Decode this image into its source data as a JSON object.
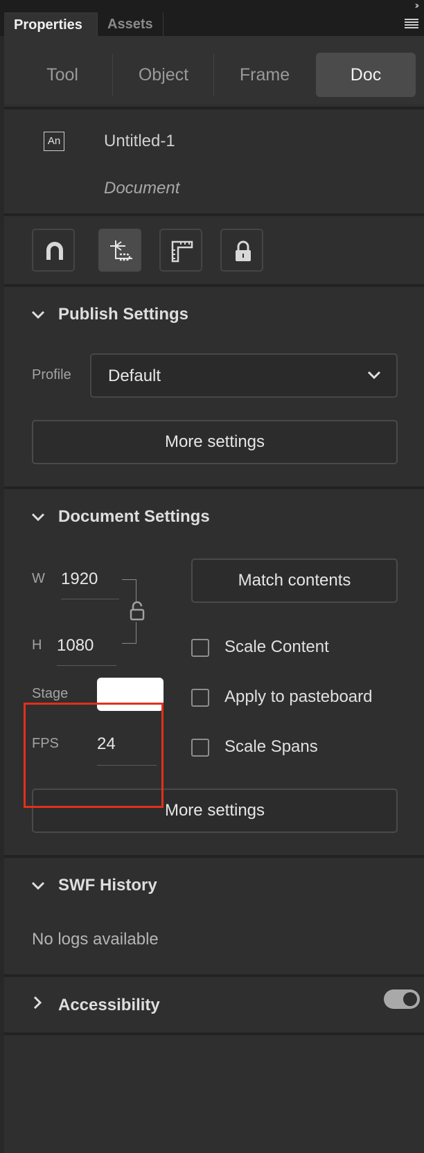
{
  "panel_tabs": {
    "active": "Properties",
    "inactive": "Assets"
  },
  "segments": [
    "Tool",
    "Object",
    "Frame",
    "Doc"
  ],
  "active_segment": "Doc",
  "document": {
    "icon_text": "An",
    "title": "Untitled-1",
    "subtitle": "Document"
  },
  "toolbar_icons": [
    "magnet-icon",
    "crop-icon",
    "ruler-icon",
    "lock-icon"
  ],
  "publish": {
    "heading": "Publish Settings",
    "profile_label": "Profile",
    "profile_value": "Default",
    "more_settings": "More settings"
  },
  "doc_settings": {
    "heading": "Document Settings",
    "w_label": "W",
    "w_value": "1920",
    "h_label": "H",
    "h_value": "1080",
    "match_contents": "Match contents",
    "stage_label": "Stage",
    "stage_color": "#ffffff",
    "fps_label": "FPS",
    "fps_value": "24",
    "scale_content": "Scale Content",
    "apply_pasteboard": "Apply to pasteboard",
    "scale_spans": "Scale Spans",
    "more_settings": "More settings"
  },
  "swf_history": {
    "heading": "SWF History",
    "message": "No logs available"
  },
  "accessibility": {
    "heading": "Accessibility",
    "toggle_on": true
  },
  "colors": {
    "highlight": "#e2301c",
    "panel_bg": "#2f2f2f",
    "active_tab": "#4b4b4b"
  }
}
